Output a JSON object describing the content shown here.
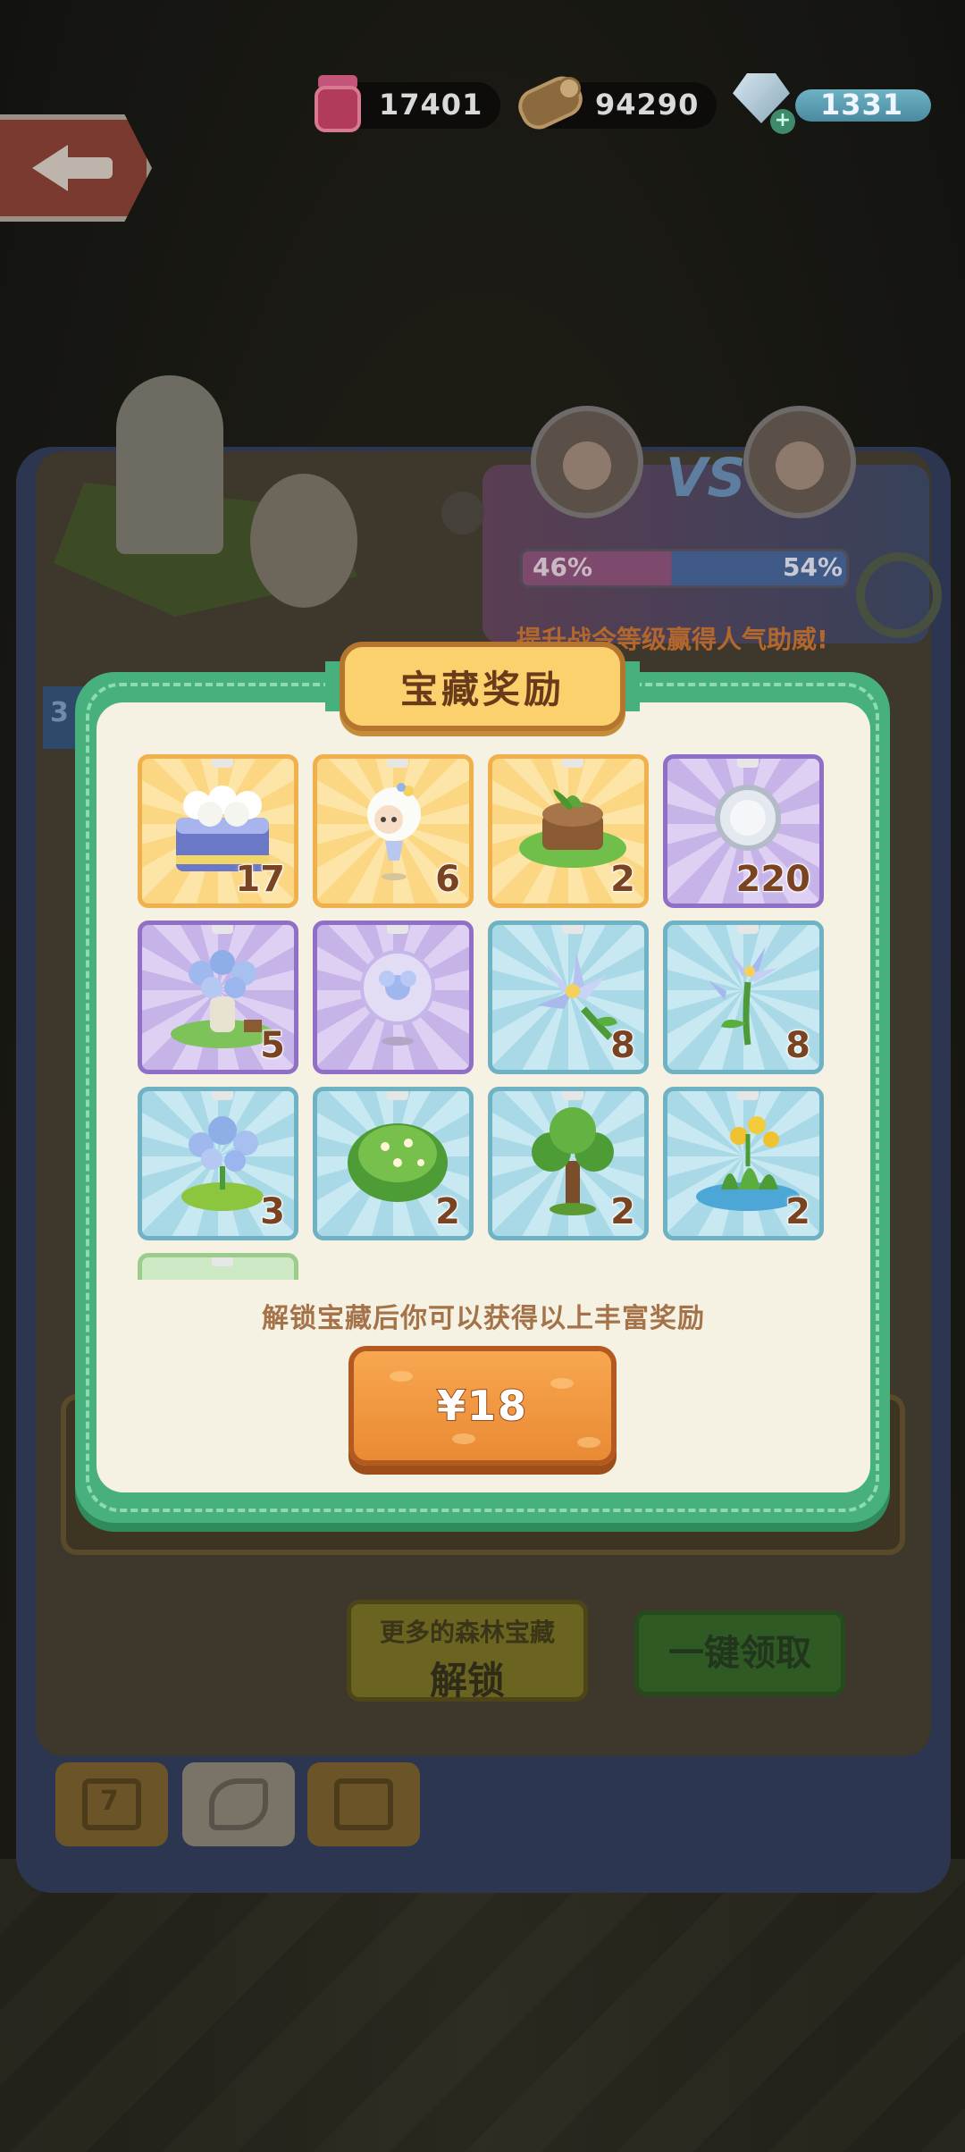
{
  "resources": {
    "jam": {
      "value": "17401",
      "icon": "jam-jar-icon"
    },
    "wood": {
      "value": "94290",
      "icon": "wood-log-icon"
    },
    "gems": {
      "value": "1331",
      "icon": "diamond-icon",
      "add_icon": "plus-icon"
    }
  },
  "background": {
    "vs_label": "VS",
    "left_pct": "46%",
    "right_pct": "54%",
    "info_text": "提升战令等级赢得人气助威!",
    "level_badge": "3",
    "unlock_button": {
      "small_label": "更多的森林宝藏",
      "label": "解锁"
    },
    "claim_button": "一键领取",
    "tabs": [
      {
        "name": "calendar-tab",
        "label": "7"
      },
      {
        "name": "flag-tab",
        "label": ""
      },
      {
        "name": "treasure-tab",
        "label": ""
      }
    ]
  },
  "modal": {
    "title": "宝藏奖励",
    "rewards": [
      {
        "name": "reward-cake-set",
        "count": "17",
        "rarity": "gold",
        "icon": "cake-icon"
      },
      {
        "name": "reward-fairy-doll",
        "count": "6",
        "rarity": "gold",
        "icon": "fairy-icon"
      },
      {
        "name": "reward-stump-plant",
        "count": "2",
        "rarity": "gold",
        "icon": "stump-icon"
      },
      {
        "name": "reward-silver-coin",
        "count": "220",
        "rarity": "purple",
        "icon": "coin-icon"
      },
      {
        "name": "reward-flower-vase",
        "count": "5",
        "rarity": "purple",
        "icon": "vase-icon"
      },
      {
        "name": "reward-flower-globe",
        "count": "",
        "rarity": "purple",
        "icon": "globe-icon"
      },
      {
        "name": "reward-lily-flower",
        "count": "8",
        "rarity": "blue",
        "icon": "lily-icon"
      },
      {
        "name": "reward-lily-stem",
        "count": "8",
        "rarity": "blue",
        "icon": "lily-stem-icon"
      },
      {
        "name": "reward-flower-bush",
        "count": "3",
        "rarity": "blue",
        "icon": "flower-bush-icon"
      },
      {
        "name": "reward-green-shrub",
        "count": "2",
        "rarity": "blue",
        "icon": "shrub-icon"
      },
      {
        "name": "reward-tree",
        "count": "2",
        "rarity": "blue",
        "icon": "tree-icon"
      },
      {
        "name": "reward-yellow-plant",
        "count": "2",
        "rarity": "blue",
        "icon": "yellow-plant-icon"
      },
      {
        "name": "reward-partial",
        "count": "",
        "rarity": "green",
        "icon": "item-icon"
      }
    ],
    "caption": "解锁宝藏后你可以获得以上丰富奖励",
    "price_button": "¥18"
  },
  "colors": {
    "modal_green": "#48b07c",
    "banner_yellow": "#fbd16d",
    "price_orange": "#ef9640",
    "count_brown": "#7a4422"
  }
}
